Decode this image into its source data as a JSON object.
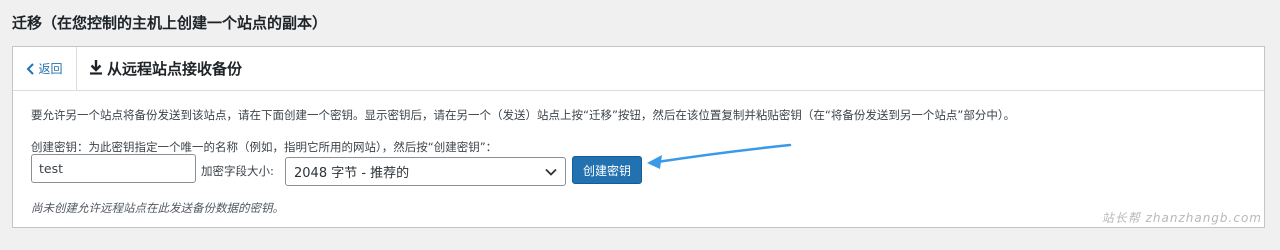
{
  "page": {
    "title": "迁移（在您控制的主机上创建一个站点的副本）"
  },
  "panel": {
    "back_label": "返回",
    "header_title": "从远程站点接收备份",
    "description": "要允许另一个站点将备份发送到该站点，请在下面创建一个密钥。显示密钥后，请在另一个（发送）站点上按“迁移”按钮，然后在该位置复制并粘贴密钥（在“将备份发送到另一个站点”部分中）。",
    "create_key_label": "创建密钥：为此密钥指定一个唯一的名称（例如，指明它所用的网站），然后按“创建密钥”：",
    "key_name_value": "test",
    "encryption_size_label": "加密字段大小:",
    "encryption_size_selected": "2048 字节 - 推荐的",
    "create_key_button": "创建密钥",
    "no_keys_note": "尚未创建允许远程站点在此发送备份数据的密钥。"
  },
  "watermark": "站长帮 zhanzhangb.com",
  "colors": {
    "accent": "#2271b1",
    "annotation_arrow": "#3a9ae8"
  },
  "icons": {
    "back": "chevron-left-icon",
    "header": "download-icon",
    "select": "chevron-down-icon"
  }
}
